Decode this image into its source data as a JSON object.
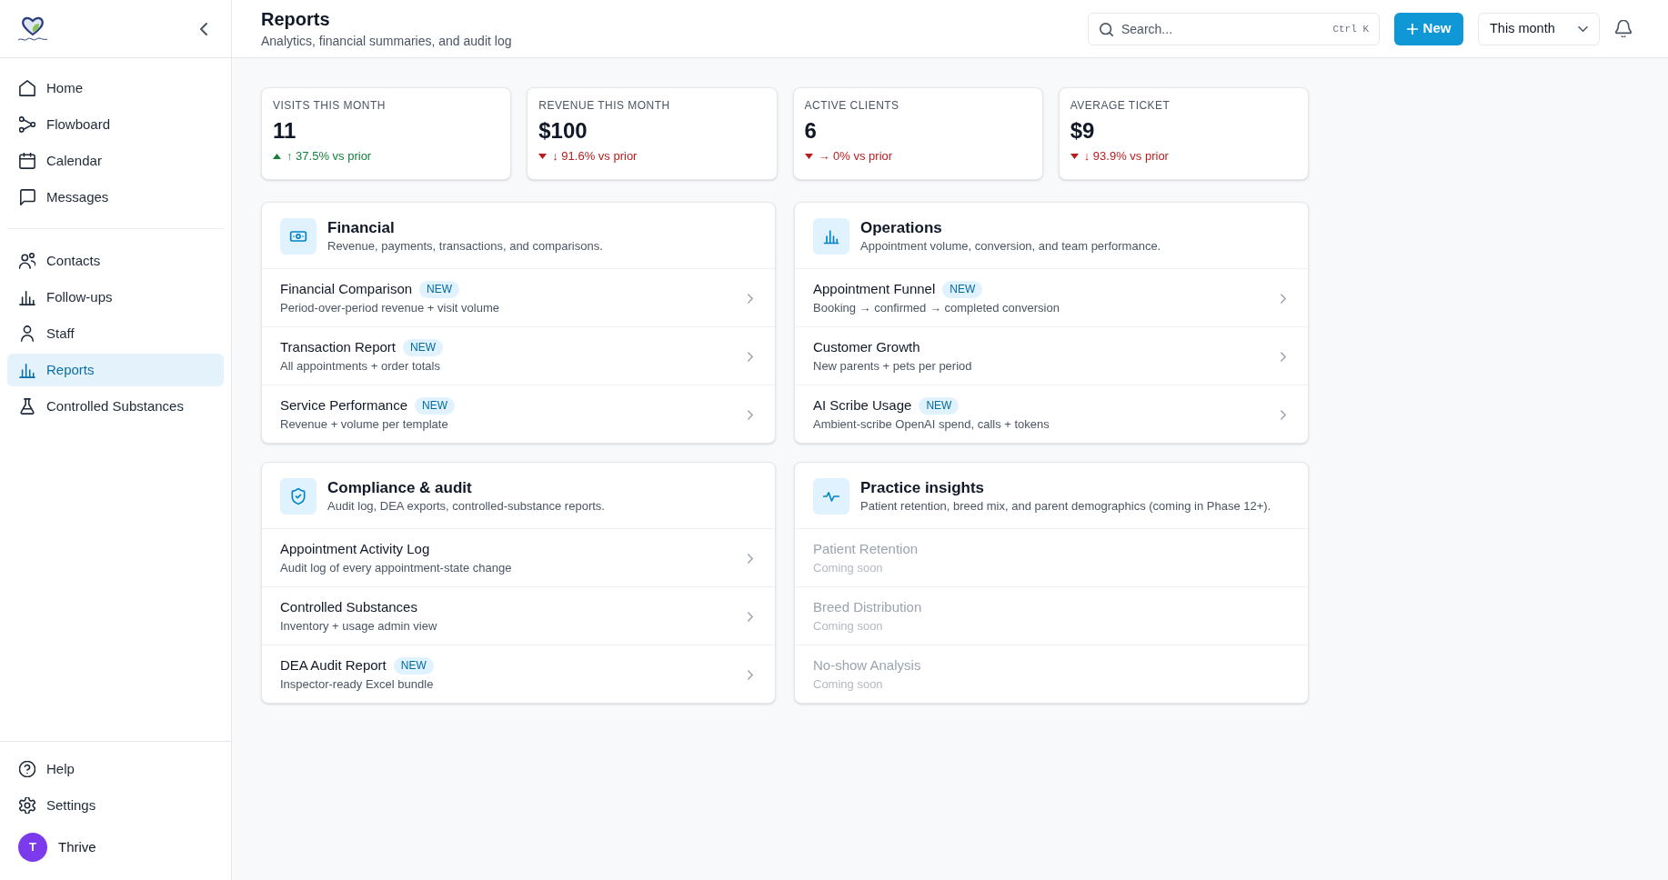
{
  "sidebar": {
    "nav_groups": [
      {
        "items": [
          {
            "label": "Home",
            "selected": false
          },
          {
            "label": "Flowboard",
            "selected": false
          },
          {
            "label": "Calendar",
            "selected": false
          },
          {
            "label": "Messages",
            "selected": false
          }
        ]
      },
      {
        "items": [
          {
            "label": "Contacts",
            "selected": false
          },
          {
            "label": "Follow-ups",
            "selected": false
          },
          {
            "label": "Staff",
            "selected": false
          },
          {
            "label": "Reports",
            "selected": true
          },
          {
            "label": "Controlled Substances",
            "selected": false
          }
        ]
      }
    ],
    "footer_items": [
      {
        "label": "Help",
        "selected": false
      },
      {
        "label": "Settings",
        "selected": false
      }
    ],
    "user": {
      "initial": "T",
      "name": "Thrive"
    }
  },
  "header": {
    "title": "Reports",
    "subtitle": "Analytics, financial summaries, and audit log",
    "search": {
      "placeholder": "Search...",
      "shortcut": "Ctrl K"
    },
    "new_button": {
      "label": "New"
    },
    "period_select": {
      "value": "This month"
    }
  },
  "stats": [
    {
      "label": "VISITS THIS MONTH",
      "value": "11",
      "rising": true,
      "change": "↑ 37.5% vs prior"
    },
    {
      "label": "REVENUE THIS MONTH",
      "value": "$100",
      "rising": false,
      "change": "↓ 91.6% vs prior"
    },
    {
      "label": "ACTIVE CLIENTS",
      "value": "6",
      "rising": false,
      "change": "→ 0% vs prior"
    },
    {
      "label": "AVERAGE TICKET",
      "value": "$9",
      "rising": false,
      "change": "↓ 93.9% vs prior"
    }
  ],
  "sections": [
    {
      "title": "Financial",
      "description": "Revenue, payments, transactions, and comparisons.",
      "items": [
        {
          "title": "Financial Comparison",
          "badge": "NEW",
          "subtitle": "Period-over-period revenue + visit volume",
          "disabled": false
        },
        {
          "title": "Transaction Report",
          "badge": "NEW",
          "subtitle": "All appointments + order totals",
          "disabled": false
        },
        {
          "title": "Service Performance",
          "badge": "NEW",
          "subtitle": "Revenue + volume per template",
          "disabled": false
        }
      ]
    },
    {
      "title": "Operations",
      "description": "Appointment volume, conversion, and team performance.",
      "items": [
        {
          "title": "Appointment Funnel",
          "badge": "NEW",
          "subtitle": "Booking → confirmed → completed conversion",
          "disabled": false
        },
        {
          "title": "Customer Growth",
          "subtitle": "New parents + pets per period",
          "disabled": false
        },
        {
          "title": "AI Scribe Usage",
          "badge": "NEW",
          "subtitle": "Ambient-scribe OpenAI spend, calls + tokens",
          "disabled": false
        }
      ]
    },
    {
      "title": "Compliance & audit",
      "description": "Audit log, DEA exports, controlled-substance reports.",
      "items": [
        {
          "title": "Appointment Activity Log",
          "subtitle": "Audit log of every appointment-state change",
          "disabled": false
        },
        {
          "title": "Controlled Substances",
          "subtitle": "Inventory + usage admin view",
          "disabled": false
        },
        {
          "title": "DEA Audit Report",
          "badge": "NEW",
          "subtitle": "Inspector-ready Excel bundle",
          "disabled": false
        }
      ]
    },
    {
      "title": "Practice insights",
      "description": "Patient retention, breed mix, and parent demographics (coming in Phase 12+).",
      "items": [
        {
          "title": "Patient Retention",
          "subtitle": "Coming soon",
          "disabled": true
        },
        {
          "title": "Breed Distribution",
          "subtitle": "Coming soon",
          "disabled": true
        },
        {
          "title": "No-show Analysis",
          "subtitle": "Coming soon",
          "disabled": true
        }
      ]
    }
  ]
}
